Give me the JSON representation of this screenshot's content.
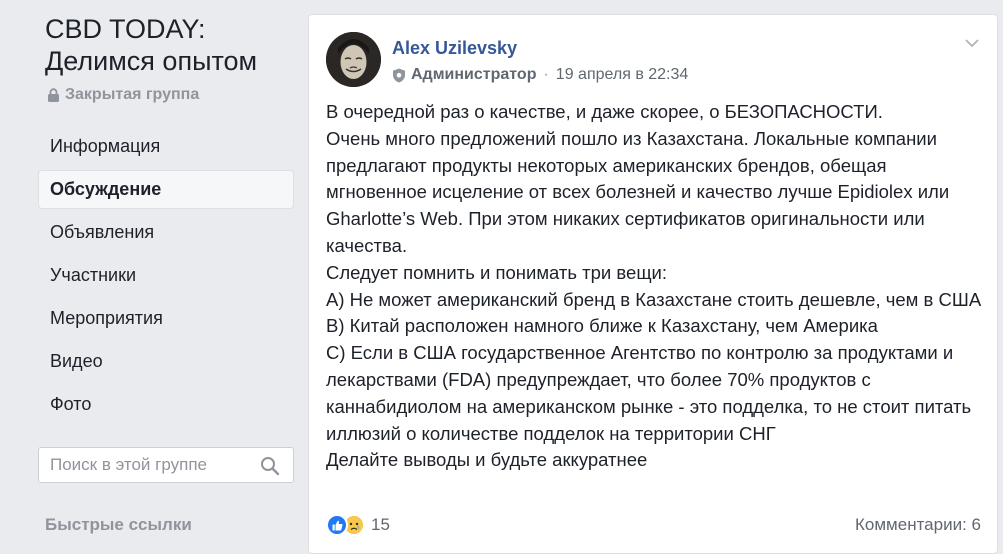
{
  "group": {
    "title_line1": "CBD TODAY:",
    "title_line2": "Делимся опытом",
    "privacy": "Закрытая группа"
  },
  "nav": {
    "items": [
      {
        "label": "Информация"
      },
      {
        "label": "Обсуждение",
        "active": true
      },
      {
        "label": "Объявления"
      },
      {
        "label": "Участники"
      },
      {
        "label": "Мероприятия"
      },
      {
        "label": "Видео"
      },
      {
        "label": "Фото"
      }
    ]
  },
  "search": {
    "placeholder": "Поиск в этой группе"
  },
  "quick_links": "Быстрые ссылки",
  "post": {
    "author": "Alex Uzilevsky",
    "role": "Администратор",
    "timestamp": "19 апреля в 22:34",
    "lines": [
      "В очередной раз о качестве, и даже скорее, о БЕЗОПАСНОСТИ.",
      "Очень много предложений пошло из Казахстана. Локальные компании предлагают продукты некоторых американских брендов, обещая мгновенное исцеление от всех болезней и качество лучше Epidiolex или Gharlotte’s Web. При этом никаких сертификатов оригинальности или качества.",
      "Следует помнить и понимать три вещи:",
      "А) Не может американский бренд в Казахстане стоить дешевле, чем в США",
      "В) Китай расположен намного ближе к Казахстану, чем Америка",
      "С) Если в США государственное Агентство по контролю за продуктами и лекарствами (FDA) предупреждает, что более 70% продуктов с каннабидиолом на американском рынке - это подделка, то не стоит питать иллюзий о количестве подделок на территории СНГ",
      "Делайте выводы и будьте аккуратнее"
    ],
    "reactions_count": "15",
    "comments": "Комментарии: 6"
  },
  "colors": {
    "background": "#e9ebee",
    "link": "#365899",
    "like": "#2078f4"
  }
}
